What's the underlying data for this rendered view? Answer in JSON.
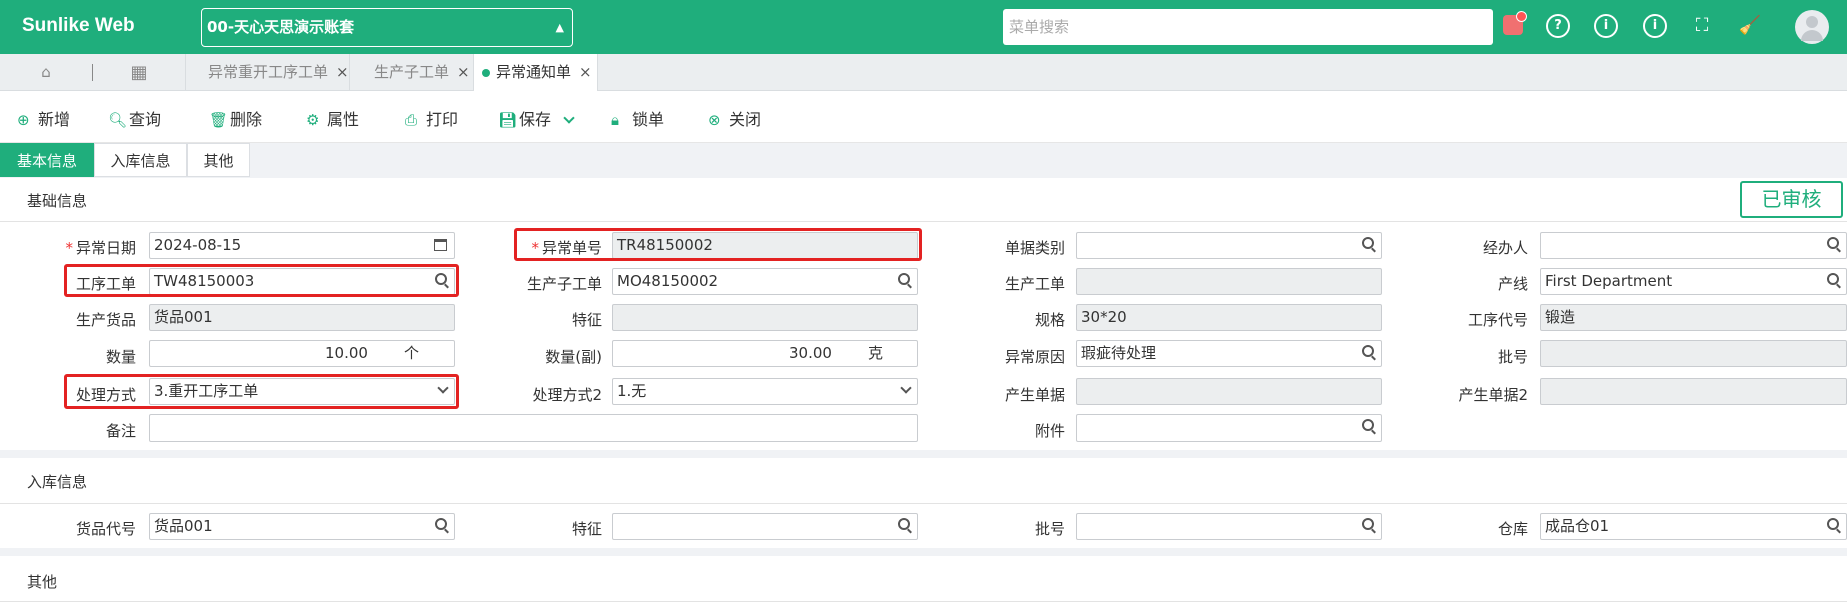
{
  "app": {
    "logo": "Sunlike Web",
    "account": "00-天心天思演示账套",
    "search_placeholder": "菜单搜索"
  },
  "tabs": [
    {
      "label": "异常重开工序工单"
    },
    {
      "label": "生产子工单"
    },
    {
      "label": "异常通知单"
    }
  ],
  "toolbar": {
    "add": "新增",
    "query": "查询",
    "delete": "删除",
    "props": "属性",
    "print": "打印",
    "save": "保存",
    "lock": "锁单",
    "close": "关闭"
  },
  "subtabs": {
    "basic": "基本信息",
    "inbound": "入库信息",
    "other": "其他"
  },
  "status": "已审核",
  "sections": {
    "basic": "基础信息",
    "inbound": "入库信息",
    "other": "其他"
  },
  "basic": {
    "exception_date_label": "异常日期",
    "exception_date": "2024-08-15",
    "exception_no_label": "异常单号",
    "exception_no": "TR48150002",
    "doc_category_label": "单据类别",
    "doc_category": "",
    "handler_label": "经办人",
    "handler": "",
    "process_order_label": "工序工单",
    "process_order": "TW48150003",
    "sub_order_label": "生产子工单",
    "sub_order": "MO48150002",
    "prod_order_label": "生产工单",
    "prod_order": "",
    "line_label": "产线",
    "line": "First Department",
    "prod_goods_label": "生产货品",
    "prod_goods": "货品001",
    "feature_label": "特征",
    "feature": "",
    "spec_label": "规格",
    "spec": "30*20",
    "proc_code_label": "工序代号",
    "proc_code": "锻造",
    "qty_label": "数量",
    "qty": "10.00",
    "qty_unit": "个",
    "qty2_label": "数量(副)",
    "qty2": "30.00",
    "qty2_unit": "克",
    "reason_label": "异常原因",
    "reason": "瑕疵待处理",
    "batch_label": "批号",
    "batch": "",
    "method_label": "处理方式",
    "method": "3.重开工序工单",
    "method2_label": "处理方式2",
    "method2": "1.无",
    "gen_doc_label": "产生单据",
    "gen_doc": "",
    "gen_doc2_label": "产生单据2",
    "gen_doc2": "",
    "remark_label": "备注",
    "remark": "",
    "attach_label": "附件",
    "attach": ""
  },
  "inbound": {
    "goods_code_label": "货品代号",
    "goods_code": "货品001",
    "feature_label": "特征",
    "feature": "",
    "batch_label": "批号",
    "batch": "",
    "warehouse_label": "仓库",
    "warehouse": "成品仓01"
  }
}
